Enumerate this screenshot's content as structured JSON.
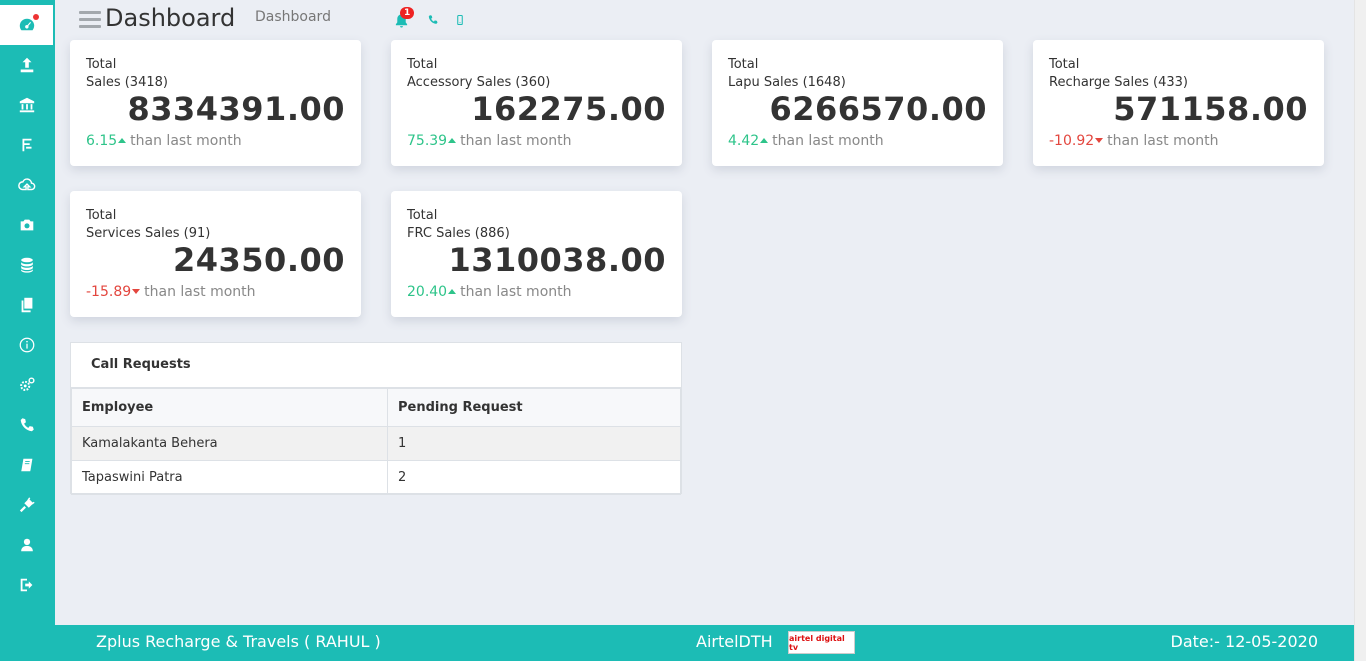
{
  "header": {
    "title": "Dashboard",
    "breadcrumb": "Dashboard",
    "notification_count": "1"
  },
  "sidebar": {
    "items": [
      {
        "icon": "dashboard-icon",
        "active": true
      },
      {
        "icon": "upload-icon"
      },
      {
        "icon": "bank-icon"
      },
      {
        "icon": "receipt-icon"
      },
      {
        "icon": "cloud-upload-icon"
      },
      {
        "icon": "camera-icon"
      },
      {
        "icon": "database-icon"
      },
      {
        "icon": "copy-icon"
      },
      {
        "icon": "info-icon"
      },
      {
        "icon": "settings-icon"
      },
      {
        "icon": "phone-icon"
      },
      {
        "icon": "book-icon"
      },
      {
        "icon": "plug-icon"
      },
      {
        "icon": "user-icon"
      },
      {
        "icon": "logout-icon"
      }
    ]
  },
  "cards": [
    {
      "line1": "Total",
      "line2": "Sales (3418)",
      "value": "8334391.00",
      "change": "6.15",
      "direction": "up",
      "suffix": "than last month"
    },
    {
      "line1": "Total",
      "line2": "Accessory Sales (360)",
      "value": "162275.00",
      "change": "75.39",
      "direction": "up",
      "suffix": "than last month"
    },
    {
      "line1": "Total",
      "line2": "Lapu Sales (1648)",
      "value": "6266570.00",
      "change": "4.42",
      "direction": "up",
      "suffix": "than last month"
    },
    {
      "line1": "Total",
      "line2": "Recharge Sales (433)",
      "value": "571158.00",
      "change": "-10.92",
      "direction": "down",
      "suffix": "than last month"
    },
    {
      "line1": "Total",
      "line2": "Services Sales (91)",
      "value": "24350.00",
      "change": "-15.89",
      "direction": "down",
      "suffix": "than last month"
    },
    {
      "line1": "Total",
      "line2": "FRC Sales (886)",
      "value": "1310038.00",
      "change": "20.40",
      "direction": "up",
      "suffix": "than last month"
    }
  ],
  "call_requests": {
    "title": "Call Requests",
    "columns": [
      "Employee",
      "Pending Request"
    ],
    "rows": [
      [
        "Kamalakanta Behera",
        "1"
      ],
      [
        "Tapaswini Patra",
        "2"
      ]
    ]
  },
  "footer": {
    "left": "Zplus Recharge & Travels ( RAHUL )",
    "middle": "AirtelDTH",
    "logo_text": "airtel digital tv",
    "right": "Date:- 12-05-2020"
  },
  "colors": {
    "accent": "#1cbcb5",
    "positive": "#2ec48a",
    "negative": "#e3463e"
  }
}
